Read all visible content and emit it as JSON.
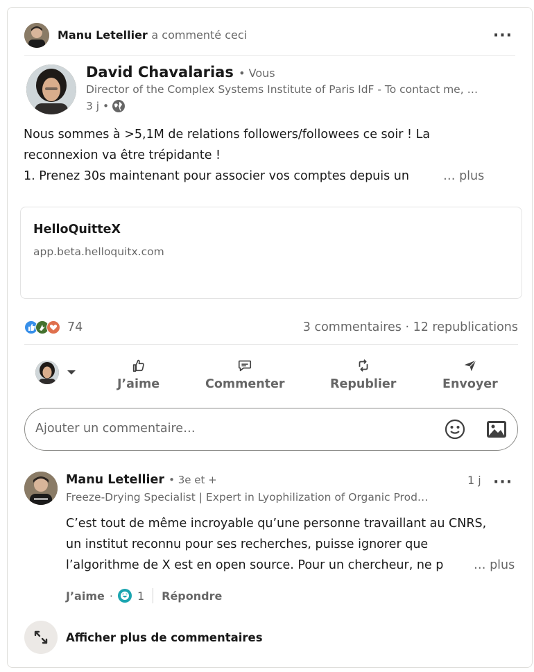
{
  "context": {
    "actor_name": "Manu Letellier",
    "action_text": "a commenté ceci",
    "more_icon": "ellipsis-icon"
  },
  "post": {
    "author_name": "David Chavalarias",
    "author_degree": "• Vous",
    "author_headline": "Director of the Complex Systems Institute of Paris IdF - To contact me, …",
    "time": "3 j •",
    "visibility_icon": "globe-icon",
    "text_lines": [
      "Nous sommes à >5,1M de relations followers/followees ce soir ! La",
      "reconnexion va être trépidante !",
      "1. Prenez 30s maintenant pour associer vos comptes depuis un"
    ],
    "see_more": "… plus"
  },
  "link_preview": {
    "title": "HelloQuitteX",
    "url": "app.beta.helloquitx.com"
  },
  "social_counts": {
    "reactions_count": "74",
    "comments_reposts": "3 commentaires · 12 republications",
    "reaction_icons": [
      "like-icon",
      "celebrate-icon",
      "love-icon"
    ]
  },
  "actions": {
    "like": "J’aime",
    "comment": "Commenter",
    "repost": "Republier",
    "send": "Envoyer"
  },
  "comment_input": {
    "placeholder": "Ajouter un commentaire…",
    "emoji_icon": "emoji-icon",
    "image_icon": "image-icon"
  },
  "comment": {
    "author_name": "Manu Letellier",
    "author_degree": "• 3e et +",
    "time": "1 j",
    "headline": "Freeze-Drying Specialist | Expert in Lyophilization of Organic Prod…",
    "text_lines": [
      "C’est tout de même incroyable qu’une personne travaillant au CNRS,",
      "un institut reconnu pour ses recherches, puisse ignorer que",
      "l’algorithme de X est en open source. Pour un chercheur, ne p"
    ],
    "see_more": "… plus",
    "like_label": "J’aime",
    "dot": "·",
    "reaction_count": "1",
    "reply_label": "Répondre"
  },
  "load_more": {
    "label": "Afficher plus de commentaires"
  },
  "colors": {
    "like_blue": "#378fe9",
    "celebrate_green": "#44712e",
    "love_red": "#df704d",
    "funny_teal": "#1ba5b0"
  }
}
